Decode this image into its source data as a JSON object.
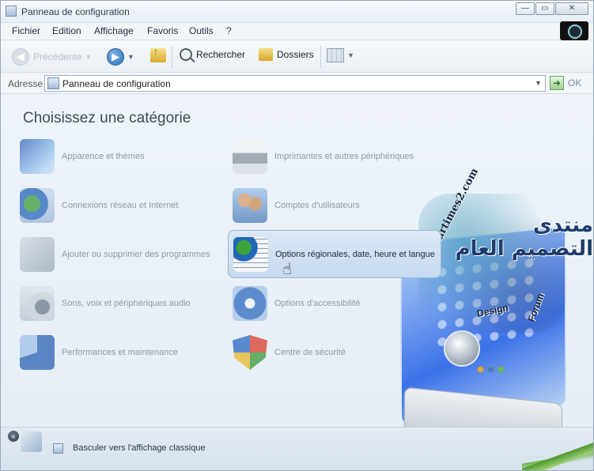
{
  "window": {
    "title": "Panneau de configuration",
    "buttons": {
      "minimize": "—",
      "maximize": "▭",
      "close": "✕"
    }
  },
  "menu": [
    "Fichier",
    "Edition",
    "Affichage",
    "Favoris",
    "Outils",
    "?"
  ],
  "toolbar": {
    "back_label": "Précédente",
    "search_label": "Rechercher",
    "folders_label": "Dossiers"
  },
  "address": {
    "label": "Adresse",
    "value": "Panneau de configuration",
    "go_label": "OK"
  },
  "main": {
    "heading": "Choisissez une catégorie",
    "categories_left": [
      {
        "label": "Apparence et thèmes",
        "icon": "appearance-themes-icon"
      },
      {
        "label": "Connexions réseau et Internet",
        "icon": "network-connections-icon"
      },
      {
        "label": "Ajouter ou supprimer des programmes",
        "icon": "add-remove-programs-icon"
      },
      {
        "label": "Sons, voix et périphériques audio",
        "icon": "sounds-audio-icon"
      },
      {
        "label": "Performances et maintenance",
        "icon": "performance-maintenance-icon"
      }
    ],
    "categories_right": [
      {
        "label": "Imprimantes et autres périphériques",
        "icon": "printer-icon"
      },
      {
        "label": "Comptes d'utilisateurs",
        "icon": "user-accounts-icon"
      },
      {
        "label": "Options régionales, date, heure et langue",
        "icon": "regional-options-icon",
        "highlighted": true
      },
      {
        "label": "Options d'accessibilité",
        "icon": "accessibility-icon"
      },
      {
        "label": "Centre de sécurité",
        "icon": "security-center-icon"
      }
    ]
  },
  "watermark": {
    "arabic": "منتدى التصميم العام",
    "site": "Startimes2.com",
    "design": "Design",
    "forum": "Forum"
  },
  "bottom": {
    "switch_label": "Basculer vers l'affichage classique",
    "collapse_glyph": "«"
  },
  "colors": {
    "highlight_bg": "#c7daef",
    "highlight_border": "#9ab5d3",
    "heading": "#3d4b5a",
    "dim_text": "#8e99a4"
  }
}
